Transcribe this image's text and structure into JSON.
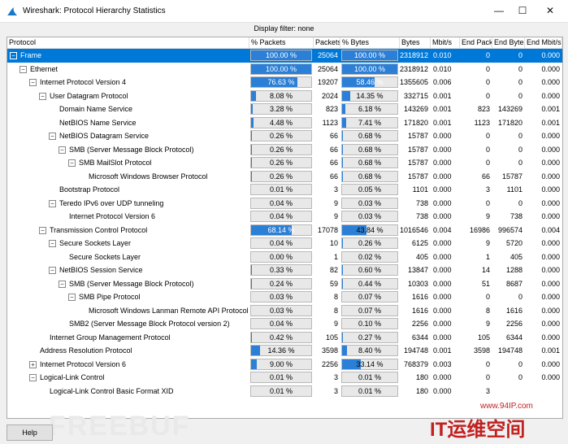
{
  "window": {
    "title": "Wireshark: Protocol Hierarchy Statistics",
    "min": "—",
    "max": "☐",
    "close": "✕"
  },
  "filter_label": "Display filter: none",
  "columns": [
    "Protocol",
    "% Packets",
    "Packets",
    "% Bytes",
    "Bytes",
    "Mbit/s",
    "End Packets",
    "End Bytes",
    "End Mbit/s"
  ],
  "rows": [
    {
      "protocol": "Frame",
      "level": 0,
      "toggle": "−",
      "pct_packets": "100.00 %",
      "pct_packets_val": 100,
      "packets": "25064",
      "pct_bytes": "100.00 %",
      "pct_bytes_val": 100,
      "bytes": "2318912",
      "mbit": "0.010",
      "end_packets": "0",
      "end_bytes": "0",
      "end_mbit": "0.000",
      "selected": true
    },
    {
      "protocol": "Ethernet",
      "level": 1,
      "toggle": "−",
      "pct_packets": "100.00 %",
      "pct_packets_val": 100,
      "packets": "25064",
      "pct_bytes": "100.00 %",
      "pct_bytes_val": 100,
      "bytes": "2318912",
      "mbit": "0.010",
      "end_packets": "0",
      "end_bytes": "0",
      "end_mbit": "0.000"
    },
    {
      "protocol": "Internet Protocol Version 4",
      "level": 2,
      "toggle": "−",
      "pct_packets": "76.63 %",
      "pct_packets_val": 76.63,
      "packets": "19207",
      "pct_bytes": "58.46 %",
      "pct_bytes_val": 58.46,
      "bytes": "1355605",
      "mbit": "0.006",
      "end_packets": "0",
      "end_bytes": "0",
      "end_mbit": "0.000"
    },
    {
      "protocol": "User Datagram Protocol",
      "level": 3,
      "toggle": "−",
      "pct_packets": "8.08 %",
      "pct_packets_val": 8.08,
      "packets": "2024",
      "pct_bytes": "14.35 %",
      "pct_bytes_val": 14.35,
      "bytes": "332715",
      "mbit": "0.001",
      "end_packets": "0",
      "end_bytes": "0",
      "end_mbit": "0.000"
    },
    {
      "protocol": "Domain Name Service",
      "level": 4,
      "toggle": "",
      "pct_packets": "3.28 %",
      "pct_packets_val": 3.28,
      "packets": "823",
      "pct_bytes": "6.18 %",
      "pct_bytes_val": 6.18,
      "bytes": "143269",
      "mbit": "0.001",
      "end_packets": "823",
      "end_bytes": "143269",
      "end_mbit": "0.001"
    },
    {
      "protocol": "NetBIOS Name Service",
      "level": 4,
      "toggle": "",
      "pct_packets": "4.48 %",
      "pct_packets_val": 4.48,
      "packets": "1123",
      "pct_bytes": "7.41 %",
      "pct_bytes_val": 7.41,
      "bytes": "171820",
      "mbit": "0.001",
      "end_packets": "1123",
      "end_bytes": "171820",
      "end_mbit": "0.001"
    },
    {
      "protocol": "NetBIOS Datagram Service",
      "level": 4,
      "toggle": "−",
      "pct_packets": "0.26 %",
      "pct_packets_val": 0.26,
      "packets": "66",
      "pct_bytes": "0.68 %",
      "pct_bytes_val": 0.68,
      "bytes": "15787",
      "mbit": "0.000",
      "end_packets": "0",
      "end_bytes": "0",
      "end_mbit": "0.000"
    },
    {
      "protocol": "SMB (Server Message Block Protocol)",
      "level": 5,
      "toggle": "−",
      "pct_packets": "0.26 %",
      "pct_packets_val": 0.26,
      "packets": "66",
      "pct_bytes": "0.68 %",
      "pct_bytes_val": 0.68,
      "bytes": "15787",
      "mbit": "0.000",
      "end_packets": "0",
      "end_bytes": "0",
      "end_mbit": "0.000"
    },
    {
      "protocol": "SMB MailSlot Protocol",
      "level": 6,
      "toggle": "−",
      "pct_packets": "0.26 %",
      "pct_packets_val": 0.26,
      "packets": "66",
      "pct_bytes": "0.68 %",
      "pct_bytes_val": 0.68,
      "bytes": "15787",
      "mbit": "0.000",
      "end_packets": "0",
      "end_bytes": "0",
      "end_mbit": "0.000"
    },
    {
      "protocol": "Microsoft Windows Browser Protocol",
      "level": 7,
      "toggle": "",
      "pct_packets": "0.26 %",
      "pct_packets_val": 0.26,
      "packets": "66",
      "pct_bytes": "0.68 %",
      "pct_bytes_val": 0.68,
      "bytes": "15787",
      "mbit": "0.000",
      "end_packets": "66",
      "end_bytes": "15787",
      "end_mbit": "0.000"
    },
    {
      "protocol": "Bootstrap Protocol",
      "level": 4,
      "toggle": "",
      "pct_packets": "0.01 %",
      "pct_packets_val": 0.01,
      "packets": "3",
      "pct_bytes": "0.05 %",
      "pct_bytes_val": 0.05,
      "bytes": "1101",
      "mbit": "0.000",
      "end_packets": "3",
      "end_bytes": "1101",
      "end_mbit": "0.000"
    },
    {
      "protocol": "Teredo IPv6 over UDP tunneling",
      "level": 4,
      "toggle": "−",
      "pct_packets": "0.04 %",
      "pct_packets_val": 0.04,
      "packets": "9",
      "pct_bytes": "0.03 %",
      "pct_bytes_val": 0.03,
      "bytes": "738",
      "mbit": "0.000",
      "end_packets": "0",
      "end_bytes": "0",
      "end_mbit": "0.000"
    },
    {
      "protocol": "Internet Protocol Version 6",
      "level": 5,
      "toggle": "",
      "pct_packets": "0.04 %",
      "pct_packets_val": 0.04,
      "packets": "9",
      "pct_bytes": "0.03 %",
      "pct_bytes_val": 0.03,
      "bytes": "738",
      "mbit": "0.000",
      "end_packets": "9",
      "end_bytes": "738",
      "end_mbit": "0.000"
    },
    {
      "protocol": "Transmission Control Protocol",
      "level": 3,
      "toggle": "−",
      "pct_packets": "68.14 %",
      "pct_packets_val": 68.14,
      "packets": "17078",
      "pct_bytes": "43.84 %",
      "pct_bytes_val": 43.84,
      "bytes": "1016546",
      "mbit": "0.004",
      "end_packets": "16986",
      "end_bytes": "996574",
      "end_mbit": "0.004"
    },
    {
      "protocol": "Secure Sockets Layer",
      "level": 4,
      "toggle": "−",
      "pct_packets": "0.04 %",
      "pct_packets_val": 0.04,
      "packets": "10",
      "pct_bytes": "0.26 %",
      "pct_bytes_val": 0.26,
      "bytes": "6125",
      "mbit": "0.000",
      "end_packets": "9",
      "end_bytes": "5720",
      "end_mbit": "0.000"
    },
    {
      "protocol": "Secure Sockets Layer",
      "level": 5,
      "toggle": "",
      "pct_packets": "0.00 %",
      "pct_packets_val": 0,
      "packets": "1",
      "pct_bytes": "0.02 %",
      "pct_bytes_val": 0.02,
      "bytes": "405",
      "mbit": "0.000",
      "end_packets": "1",
      "end_bytes": "405",
      "end_mbit": "0.000"
    },
    {
      "protocol": "NetBIOS Session Service",
      "level": 4,
      "toggle": "−",
      "pct_packets": "0.33 %",
      "pct_packets_val": 0.33,
      "packets": "82",
      "pct_bytes": "0.60 %",
      "pct_bytes_val": 0.6,
      "bytes": "13847",
      "mbit": "0.000",
      "end_packets": "14",
      "end_bytes": "1288",
      "end_mbit": "0.000"
    },
    {
      "protocol": "SMB (Server Message Block Protocol)",
      "level": 5,
      "toggle": "−",
      "pct_packets": "0.24 %",
      "pct_packets_val": 0.24,
      "packets": "59",
      "pct_bytes": "0.44 %",
      "pct_bytes_val": 0.44,
      "bytes": "10303",
      "mbit": "0.000",
      "end_packets": "51",
      "end_bytes": "8687",
      "end_mbit": "0.000"
    },
    {
      "protocol": "SMB Pipe Protocol",
      "level": 6,
      "toggle": "−",
      "pct_packets": "0.03 %",
      "pct_packets_val": 0.03,
      "packets": "8",
      "pct_bytes": "0.07 %",
      "pct_bytes_val": 0.07,
      "bytes": "1616",
      "mbit": "0.000",
      "end_packets": "0",
      "end_bytes": "0",
      "end_mbit": "0.000"
    },
    {
      "protocol": "Microsoft Windows Lanman Remote API Protocol",
      "level": 7,
      "toggle": "",
      "pct_packets": "0.03 %",
      "pct_packets_val": 0.03,
      "packets": "8",
      "pct_bytes": "0.07 %",
      "pct_bytes_val": 0.07,
      "bytes": "1616",
      "mbit": "0.000",
      "end_packets": "8",
      "end_bytes": "1616",
      "end_mbit": "0.000"
    },
    {
      "protocol": "SMB2 (Server Message Block Protocol version 2)",
      "level": 5,
      "toggle": "",
      "pct_packets": "0.04 %",
      "pct_packets_val": 0.04,
      "packets": "9",
      "pct_bytes": "0.10 %",
      "pct_bytes_val": 0.1,
      "bytes": "2256",
      "mbit": "0.000",
      "end_packets": "9",
      "end_bytes": "2256",
      "end_mbit": "0.000"
    },
    {
      "protocol": "Internet Group Management Protocol",
      "level": 3,
      "toggle": "",
      "pct_packets": "0.42 %",
      "pct_packets_val": 0.42,
      "packets": "105",
      "pct_bytes": "0.27 %",
      "pct_bytes_val": 0.27,
      "bytes": "6344",
      "mbit": "0.000",
      "end_packets": "105",
      "end_bytes": "6344",
      "end_mbit": "0.000"
    },
    {
      "protocol": "Address Resolution Protocol",
      "level": 2,
      "toggle": "",
      "pct_packets": "14.36 %",
      "pct_packets_val": 14.36,
      "packets": "3598",
      "pct_bytes": "8.40 %",
      "pct_bytes_val": 8.4,
      "bytes": "194748",
      "mbit": "0.001",
      "end_packets": "3598",
      "end_bytes": "194748",
      "end_mbit": "0.001"
    },
    {
      "protocol": "Internet Protocol Version 6",
      "level": 2,
      "toggle": "+",
      "pct_packets": "9.00 %",
      "pct_packets_val": 9,
      "packets": "2256",
      "pct_bytes": "33.14 %",
      "pct_bytes_val": 33.14,
      "bytes": "768379",
      "mbit": "0.003",
      "end_packets": "0",
      "end_bytes": "0",
      "end_mbit": "0.000"
    },
    {
      "protocol": "Logical-Link Control",
      "level": 2,
      "toggle": "−",
      "pct_packets": "0.01 %",
      "pct_packets_val": 0.01,
      "packets": "3",
      "pct_bytes": "0.01 %",
      "pct_bytes_val": 0.01,
      "bytes": "180",
      "mbit": "0.000",
      "end_packets": "0",
      "end_bytes": "0",
      "end_mbit": "0.000"
    },
    {
      "protocol": "Logical-Link Control Basic Format XID",
      "level": 3,
      "toggle": "",
      "pct_packets": "0.01 %",
      "pct_packets_val": 0.01,
      "packets": "3",
      "pct_bytes": "0.01 %",
      "pct_bytes_val": 0.01,
      "bytes": "180",
      "mbit": "0.000",
      "end_packets": "3",
      "end_bytes": "",
      "end_mbit": ""
    }
  ],
  "help_label": "Help",
  "watermark": "FREEBUF",
  "badge": {
    "url": "www.94IP.com",
    "text": "IT运维空间"
  },
  "colors": {
    "selection": "#0078d7",
    "bar_fill": "#2b7fd6",
    "badge": "#c21f1f"
  }
}
